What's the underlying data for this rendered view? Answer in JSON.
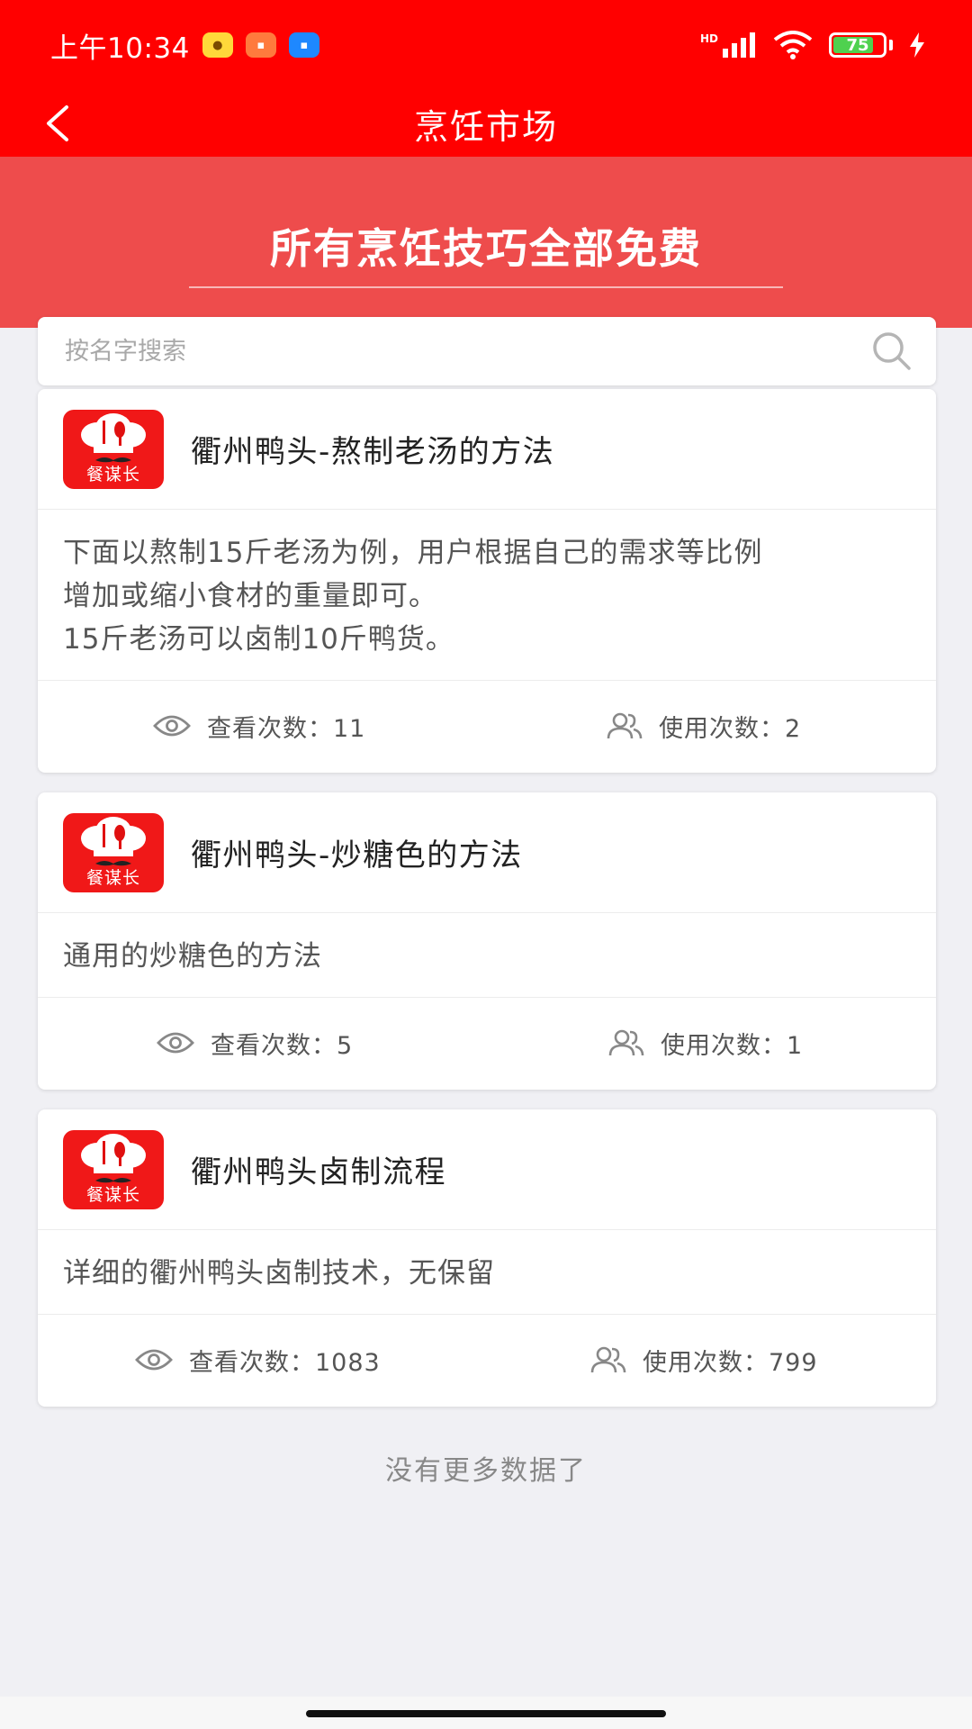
{
  "status_bar": {
    "time": "上午10:34",
    "app_icons": [
      "mascot-icon",
      "orange-app-icon",
      "blue-app-icon"
    ],
    "network": "HD",
    "battery": "75"
  },
  "nav": {
    "title": "烹饪市场"
  },
  "banner": {
    "title": "所有烹饪技巧全部免费"
  },
  "search": {
    "placeholder": "按名字搜索",
    "value": ""
  },
  "items": [
    {
      "logo_text": "餐谋长",
      "title": "衢州鸭头-熬制老汤的方法",
      "description_lines": [
        "下面以熬制15斤老汤为例，用户根据自己的需求等比例",
        "增加或缩小食材的重量即可。",
        "15斤老汤可以卤制10斤鸭货。"
      ],
      "views_label": "查看次数：11",
      "uses_label": "使用次数：2"
    },
    {
      "logo_text": "餐谋长",
      "title": "衢州鸭头-炒糖色的方法",
      "description_lines": [
        "通用的炒糖色的方法"
      ],
      "views_label": "查看次数：5",
      "uses_label": "使用次数：1"
    },
    {
      "logo_text": "餐谋长",
      "title": "衢州鸭头卤制流程",
      "description_lines": [
        "详细的衢州鸭头卤制技术，无保留"
      ],
      "views_label": "查看次数：1083",
      "uses_label": "使用次数：799"
    }
  ],
  "footer": {
    "no_more": "没有更多数据了"
  },
  "colors": {
    "header_red": "#ff0000",
    "banner_red": "#ee4c4c",
    "page_bg": "#f0f0f4"
  }
}
